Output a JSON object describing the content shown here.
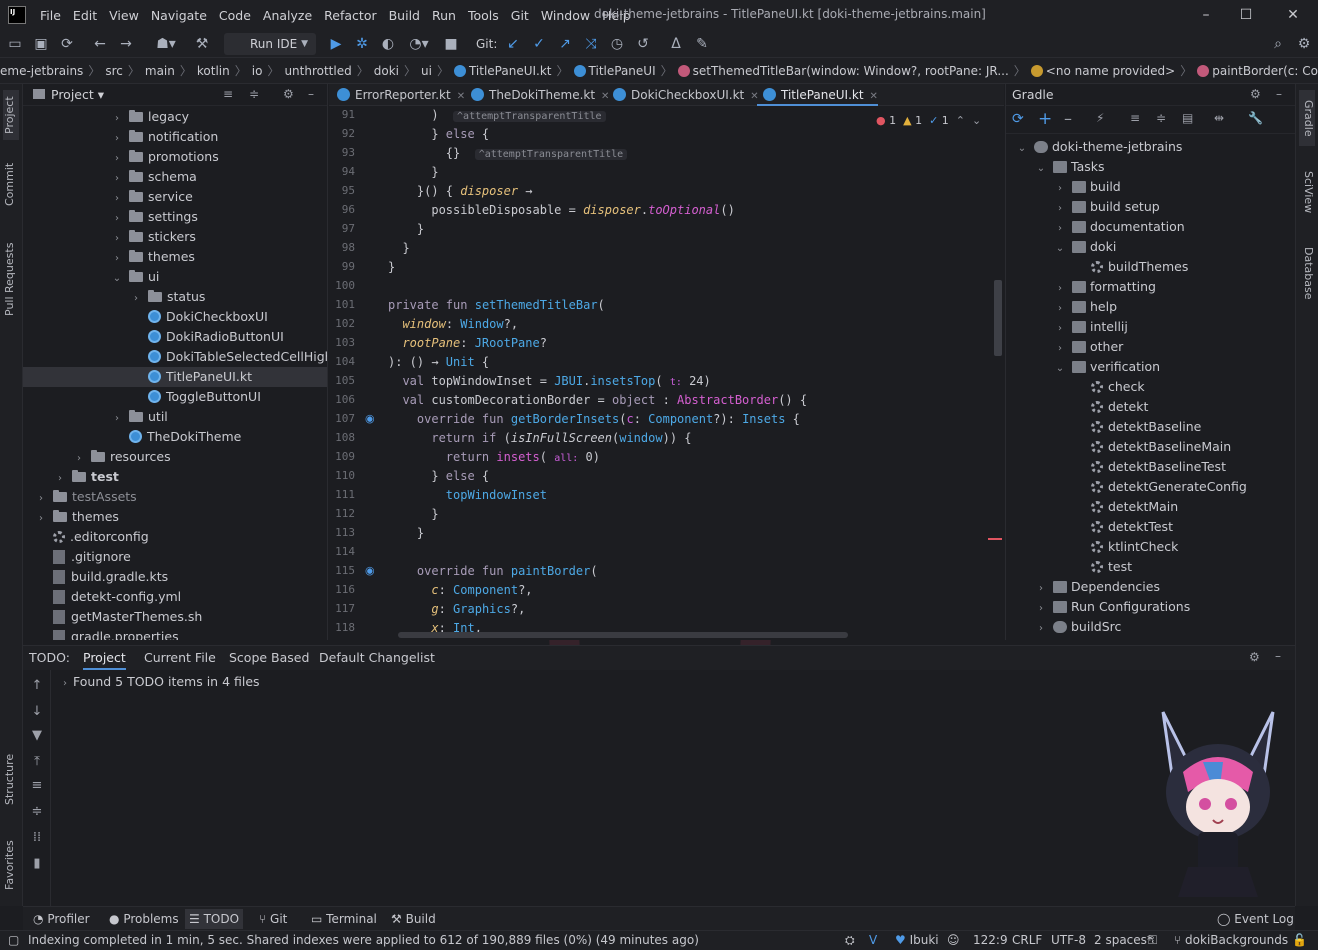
{
  "app": {
    "logo_text": "IJ",
    "menu": [
      "File",
      "Edit",
      "View",
      "Navigate",
      "Code",
      "Analyze",
      "Refactor",
      "Build",
      "Run",
      "Tools",
      "Git",
      "Window",
      "Help"
    ],
    "window_title": "doki-theme-jetbrains - TitlePaneUI.kt [doki-theme-jetbrains.main]"
  },
  "toolbar": {
    "run_config": "Run IDE",
    "git_label": "Git:"
  },
  "breadcrumb": [
    "eme-jetbrains",
    "src",
    "main",
    "kotlin",
    "io",
    "unthrottled",
    "doki",
    "ui",
    "TitlePaneUI.kt",
    "TitlePaneUI",
    "setThemedTitleBar(window: Window?, rootPane: JR...",
    "<no name provided>",
    "paintBorder(c: Component?, g: Graphics?, x: Int..."
  ],
  "stripe_left": {
    "project": "Project",
    "commit": "Commit",
    "pull_requests": "Pull Requests",
    "structure": "Structure",
    "favorites": "Favorites"
  },
  "stripe_right": {
    "gradle": "Gradle",
    "sciview": "SciView",
    "database": "Database"
  },
  "project": {
    "title": "Project",
    "tree": [
      {
        "label": "legacy",
        "indent": 4,
        "type": "folder",
        "chev": "›"
      },
      {
        "label": "notification",
        "indent": 4,
        "type": "folder",
        "chev": "›"
      },
      {
        "label": "promotions",
        "indent": 4,
        "type": "folder",
        "chev": "›"
      },
      {
        "label": "schema",
        "indent": 4,
        "type": "folder",
        "chev": "›"
      },
      {
        "label": "service",
        "indent": 4,
        "type": "folder",
        "chev": "›"
      },
      {
        "label": "settings",
        "indent": 4,
        "type": "folder",
        "chev": "›"
      },
      {
        "label": "stickers",
        "indent": 4,
        "type": "folder",
        "chev": "›"
      },
      {
        "label": "themes",
        "indent": 4,
        "type": "folder",
        "chev": "›"
      },
      {
        "label": "ui",
        "indent": 4,
        "type": "folder",
        "chev": "⌄"
      },
      {
        "label": "status",
        "indent": 5,
        "type": "folder",
        "chev": "›"
      },
      {
        "label": "DokiCheckboxUI",
        "indent": 5,
        "type": "kt",
        "chev": ""
      },
      {
        "label": "DokiRadioButtonUI",
        "indent": 5,
        "type": "kt",
        "chev": ""
      },
      {
        "label": "DokiTableSelectedCellHighlightB",
        "indent": 5,
        "type": "kt",
        "chev": ""
      },
      {
        "label": "TitlePaneUI.kt",
        "indent": 5,
        "type": "kt",
        "chev": "",
        "selected": true
      },
      {
        "label": "ToggleButtonUI",
        "indent": 5,
        "type": "kt",
        "chev": ""
      },
      {
        "label": "util",
        "indent": 4,
        "type": "folder",
        "chev": "›"
      },
      {
        "label": "TheDokiTheme",
        "indent": 4,
        "type": "kt",
        "chev": ""
      },
      {
        "label": "resources",
        "indent": 2,
        "type": "folder",
        "chev": "›"
      },
      {
        "label": "test",
        "indent": 1,
        "type": "folder",
        "chev": "›",
        "bold": true
      },
      {
        "label": "testAssets",
        "indent": 0,
        "type": "folder",
        "chev": "›",
        "muted": true
      },
      {
        "label": "themes",
        "indent": 0,
        "type": "folder",
        "chev": "›"
      },
      {
        "label": ".editorconfig",
        "indent": 0,
        "type": "gear",
        "chev": ""
      },
      {
        "label": ".gitignore",
        "indent": 0,
        "type": "file",
        "chev": ""
      },
      {
        "label": "build.gradle.kts",
        "indent": 0,
        "type": "file",
        "chev": ""
      },
      {
        "label": "detekt-config.yml",
        "indent": 0,
        "type": "file",
        "chev": ""
      },
      {
        "label": "getMasterThemes.sh",
        "indent": 0,
        "type": "file",
        "chev": ""
      },
      {
        "label": "gradle.properties",
        "indent": 0,
        "type": "file",
        "chev": ""
      }
    ]
  },
  "editor": {
    "tabs": [
      {
        "label": "ErrorReporter.kt",
        "color": "#3d8fd6"
      },
      {
        "label": "TheDokiTheme.kt",
        "color": "#3d8fd6"
      },
      {
        "label": "DokiCheckboxUI.kt",
        "color": "#3d8fd6"
      },
      {
        "label": "TitlePaneUI.kt",
        "color": "#3d8fd6",
        "active": true
      }
    ],
    "inspections": {
      "errors": "1",
      "warnings": "1",
      "typos": "1"
    },
    "line_numbers": [
      "91",
      "92",
      "93",
      "94",
      "95",
      "96",
      "97",
      "98",
      "99",
      "100",
      "101",
      "102",
      "103",
      "104",
      "105",
      "106",
      "107",
      "108",
      "109",
      "110",
      "111",
      "112",
      "113",
      "114",
      "115",
      "116",
      "117",
      "118"
    ]
  },
  "gradle": {
    "title": "Gradle",
    "tree": [
      {
        "label": "doki-theme-jetbrains",
        "indent": 0,
        "chev": "⌄",
        "type": "root"
      },
      {
        "label": "Tasks",
        "indent": 1,
        "chev": "⌄",
        "type": "folder"
      },
      {
        "label": "build",
        "indent": 2,
        "chev": "›",
        "type": "folder"
      },
      {
        "label": "build setup",
        "indent": 2,
        "chev": "›",
        "type": "folder"
      },
      {
        "label": "documentation",
        "indent": 2,
        "chev": "›",
        "type": "folder"
      },
      {
        "label": "doki",
        "indent": 2,
        "chev": "⌄",
        "type": "folder"
      },
      {
        "label": "buildThemes",
        "indent": 3,
        "chev": "",
        "type": "gear"
      },
      {
        "label": "formatting",
        "indent": 2,
        "chev": "›",
        "type": "folder"
      },
      {
        "label": "help",
        "indent": 2,
        "chev": "›",
        "type": "folder"
      },
      {
        "label": "intellij",
        "indent": 2,
        "chev": "›",
        "type": "folder"
      },
      {
        "label": "other",
        "indent": 2,
        "chev": "›",
        "type": "folder"
      },
      {
        "label": "verification",
        "indent": 2,
        "chev": "⌄",
        "type": "folder"
      },
      {
        "label": "check",
        "indent": 3,
        "chev": "",
        "type": "gear"
      },
      {
        "label": "detekt",
        "indent": 3,
        "chev": "",
        "type": "gear"
      },
      {
        "label": "detektBaseline",
        "indent": 3,
        "chev": "",
        "type": "gear"
      },
      {
        "label": "detektBaselineMain",
        "indent": 3,
        "chev": "",
        "type": "gear"
      },
      {
        "label": "detektBaselineTest",
        "indent": 3,
        "chev": "",
        "type": "gear"
      },
      {
        "label": "detektGenerateConfig",
        "indent": 3,
        "chev": "",
        "type": "gear"
      },
      {
        "label": "detektMain",
        "indent": 3,
        "chev": "",
        "type": "gear"
      },
      {
        "label": "detektTest",
        "indent": 3,
        "chev": "",
        "type": "gear"
      },
      {
        "label": "ktlintCheck",
        "indent": 3,
        "chev": "",
        "type": "gear"
      },
      {
        "label": "test",
        "indent": 3,
        "chev": "",
        "type": "gear"
      },
      {
        "label": "Dependencies",
        "indent": 1,
        "chev": "›",
        "type": "folder"
      },
      {
        "label": "Run Configurations",
        "indent": 1,
        "chev": "›",
        "type": "folder"
      },
      {
        "label": "buildSrc",
        "indent": 1,
        "chev": "›",
        "type": "root"
      }
    ]
  },
  "todo": {
    "label": "TODO:",
    "tabs": [
      "Project",
      "Current File",
      "Scope Based",
      "Default Changelist"
    ],
    "result": "Found 5 TODO items in 4 files"
  },
  "bottom_tools": [
    "Profiler",
    "Problems",
    "TODO",
    "Git",
    "Terminal",
    "Build"
  ],
  "event_log": "Event Log",
  "status": {
    "message": "Indexing completed in 1 min, 5 sec. Shared indexes were applied to 612 of 190,889 files (0%) (49 minutes ago)",
    "user": "Ibuki",
    "position": "122:9",
    "line_sep": "CRLF",
    "encoding": "UTF-8",
    "indent": "2 spaces*",
    "branch": "dokiBackgrounds"
  },
  "colors": {
    "accent": "#4f8fd6",
    "bg": "#1c1d21",
    "keyword": "#a89cb8",
    "function": "#4da9e6",
    "param": "#e5c07b"
  }
}
